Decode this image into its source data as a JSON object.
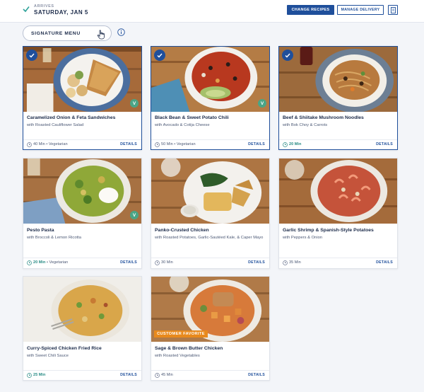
{
  "header": {
    "arrives_label": "ARRIVES",
    "arrives_date": "SATURDAY, JAN 5",
    "change_recipes": "CHANGE RECIPES",
    "manage_delivery": "MANAGE DELIVERY"
  },
  "menu": {
    "label": "SIGNATURE MENU"
  },
  "details_label": "DETAILS",
  "colors": {
    "brand_blue": "#1f4f9b",
    "veg_green": "#4aa586",
    "time_green": "#2a8c86",
    "favorite_orange": "#e8891c"
  },
  "recipes": [
    {
      "title": "Caramelized Onion & Feta Sandwiches",
      "subtitle": "with Roasted Cauliflower Salad",
      "time": "40 Min",
      "tag": "• Vegetarian",
      "selected": true,
      "vegetarian_badge": "V"
    },
    {
      "title": "Black Bean & Sweet Potato Chili",
      "subtitle": "with Avocado & Cotija Cheese",
      "time": "50 Min",
      "tag": "• Vegetarian",
      "selected": true,
      "vegetarian_badge": "V"
    },
    {
      "title": "Beef & Shiitake Mushroom Noodles",
      "subtitle": "with Bok Choy & Carrots",
      "time": "20 Min",
      "tag": "",
      "selected": true
    },
    {
      "title": "Pesto Pasta",
      "subtitle": "with Broccoli & Lemon Ricotta",
      "time": "20 Min",
      "tag": "• Vegetarian",
      "selected": false,
      "vegetarian_badge": "V"
    },
    {
      "title": "Panko-Crusted Chicken",
      "subtitle": "with Roasted Potatoes, Garlic-Sautéed Kale, & Caper Mayo",
      "time": "30 Min",
      "tag": "",
      "selected": false
    },
    {
      "title": "Garlic Shrimp & Spanish-Style Potatoes",
      "subtitle": "with Peppers & Onion",
      "time": "35 Min",
      "tag": "",
      "selected": false
    },
    {
      "title": "Curry-Spiced Chicken Fried Rice",
      "subtitle": "with Sweet Chili Sauce",
      "time": "25 Min",
      "tag": "",
      "selected": false
    },
    {
      "title": "Sage & Brown Butter Chicken",
      "subtitle": "with Roasted Vegetables",
      "time": "45 Min",
      "tag": "",
      "selected": false,
      "badge": "CUSTOMER FAVORITE"
    }
  ]
}
